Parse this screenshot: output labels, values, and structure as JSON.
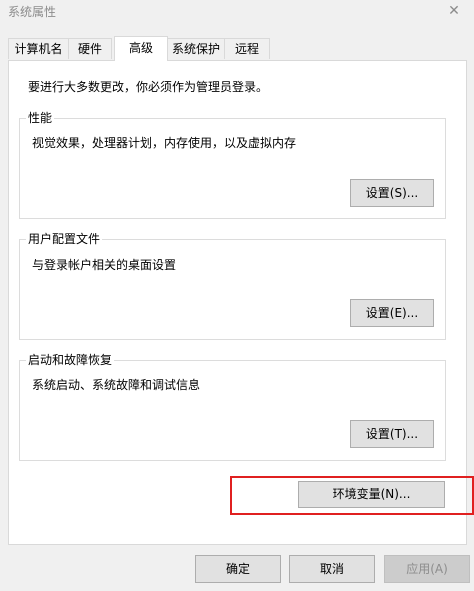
{
  "window": {
    "title": "系统属性",
    "close_glyph": "✕"
  },
  "tabs": [
    {
      "label": "计算机名",
      "active": false
    },
    {
      "label": "硬件",
      "active": false
    },
    {
      "label": "高级",
      "active": true
    },
    {
      "label": "系统保护",
      "active": false
    },
    {
      "label": "远程",
      "active": false
    }
  ],
  "advanced": {
    "admin_notice": "要进行大多数更改，你必须作为管理员登录。",
    "performance": {
      "title": "性能",
      "description": "视觉效果，处理器计划，内存使用，以及虚拟内存",
      "button": "设置(S)..."
    },
    "user_profiles": {
      "title": "用户配置文件",
      "description": "与登录帐户相关的桌面设置",
      "button": "设置(E)..."
    },
    "startup_recovery": {
      "title": "启动和故障恢复",
      "description": "系统启动、系统故障和调试信息",
      "button": "设置(T)..."
    },
    "env_vars_button": "环境变量(N)..."
  },
  "dialog_buttons": {
    "ok": "确定",
    "cancel": "取消",
    "apply": "应用(A)"
  },
  "colors": {
    "highlight": "#e02020",
    "panel": "#ffffff",
    "window": "#f0f0f0"
  }
}
